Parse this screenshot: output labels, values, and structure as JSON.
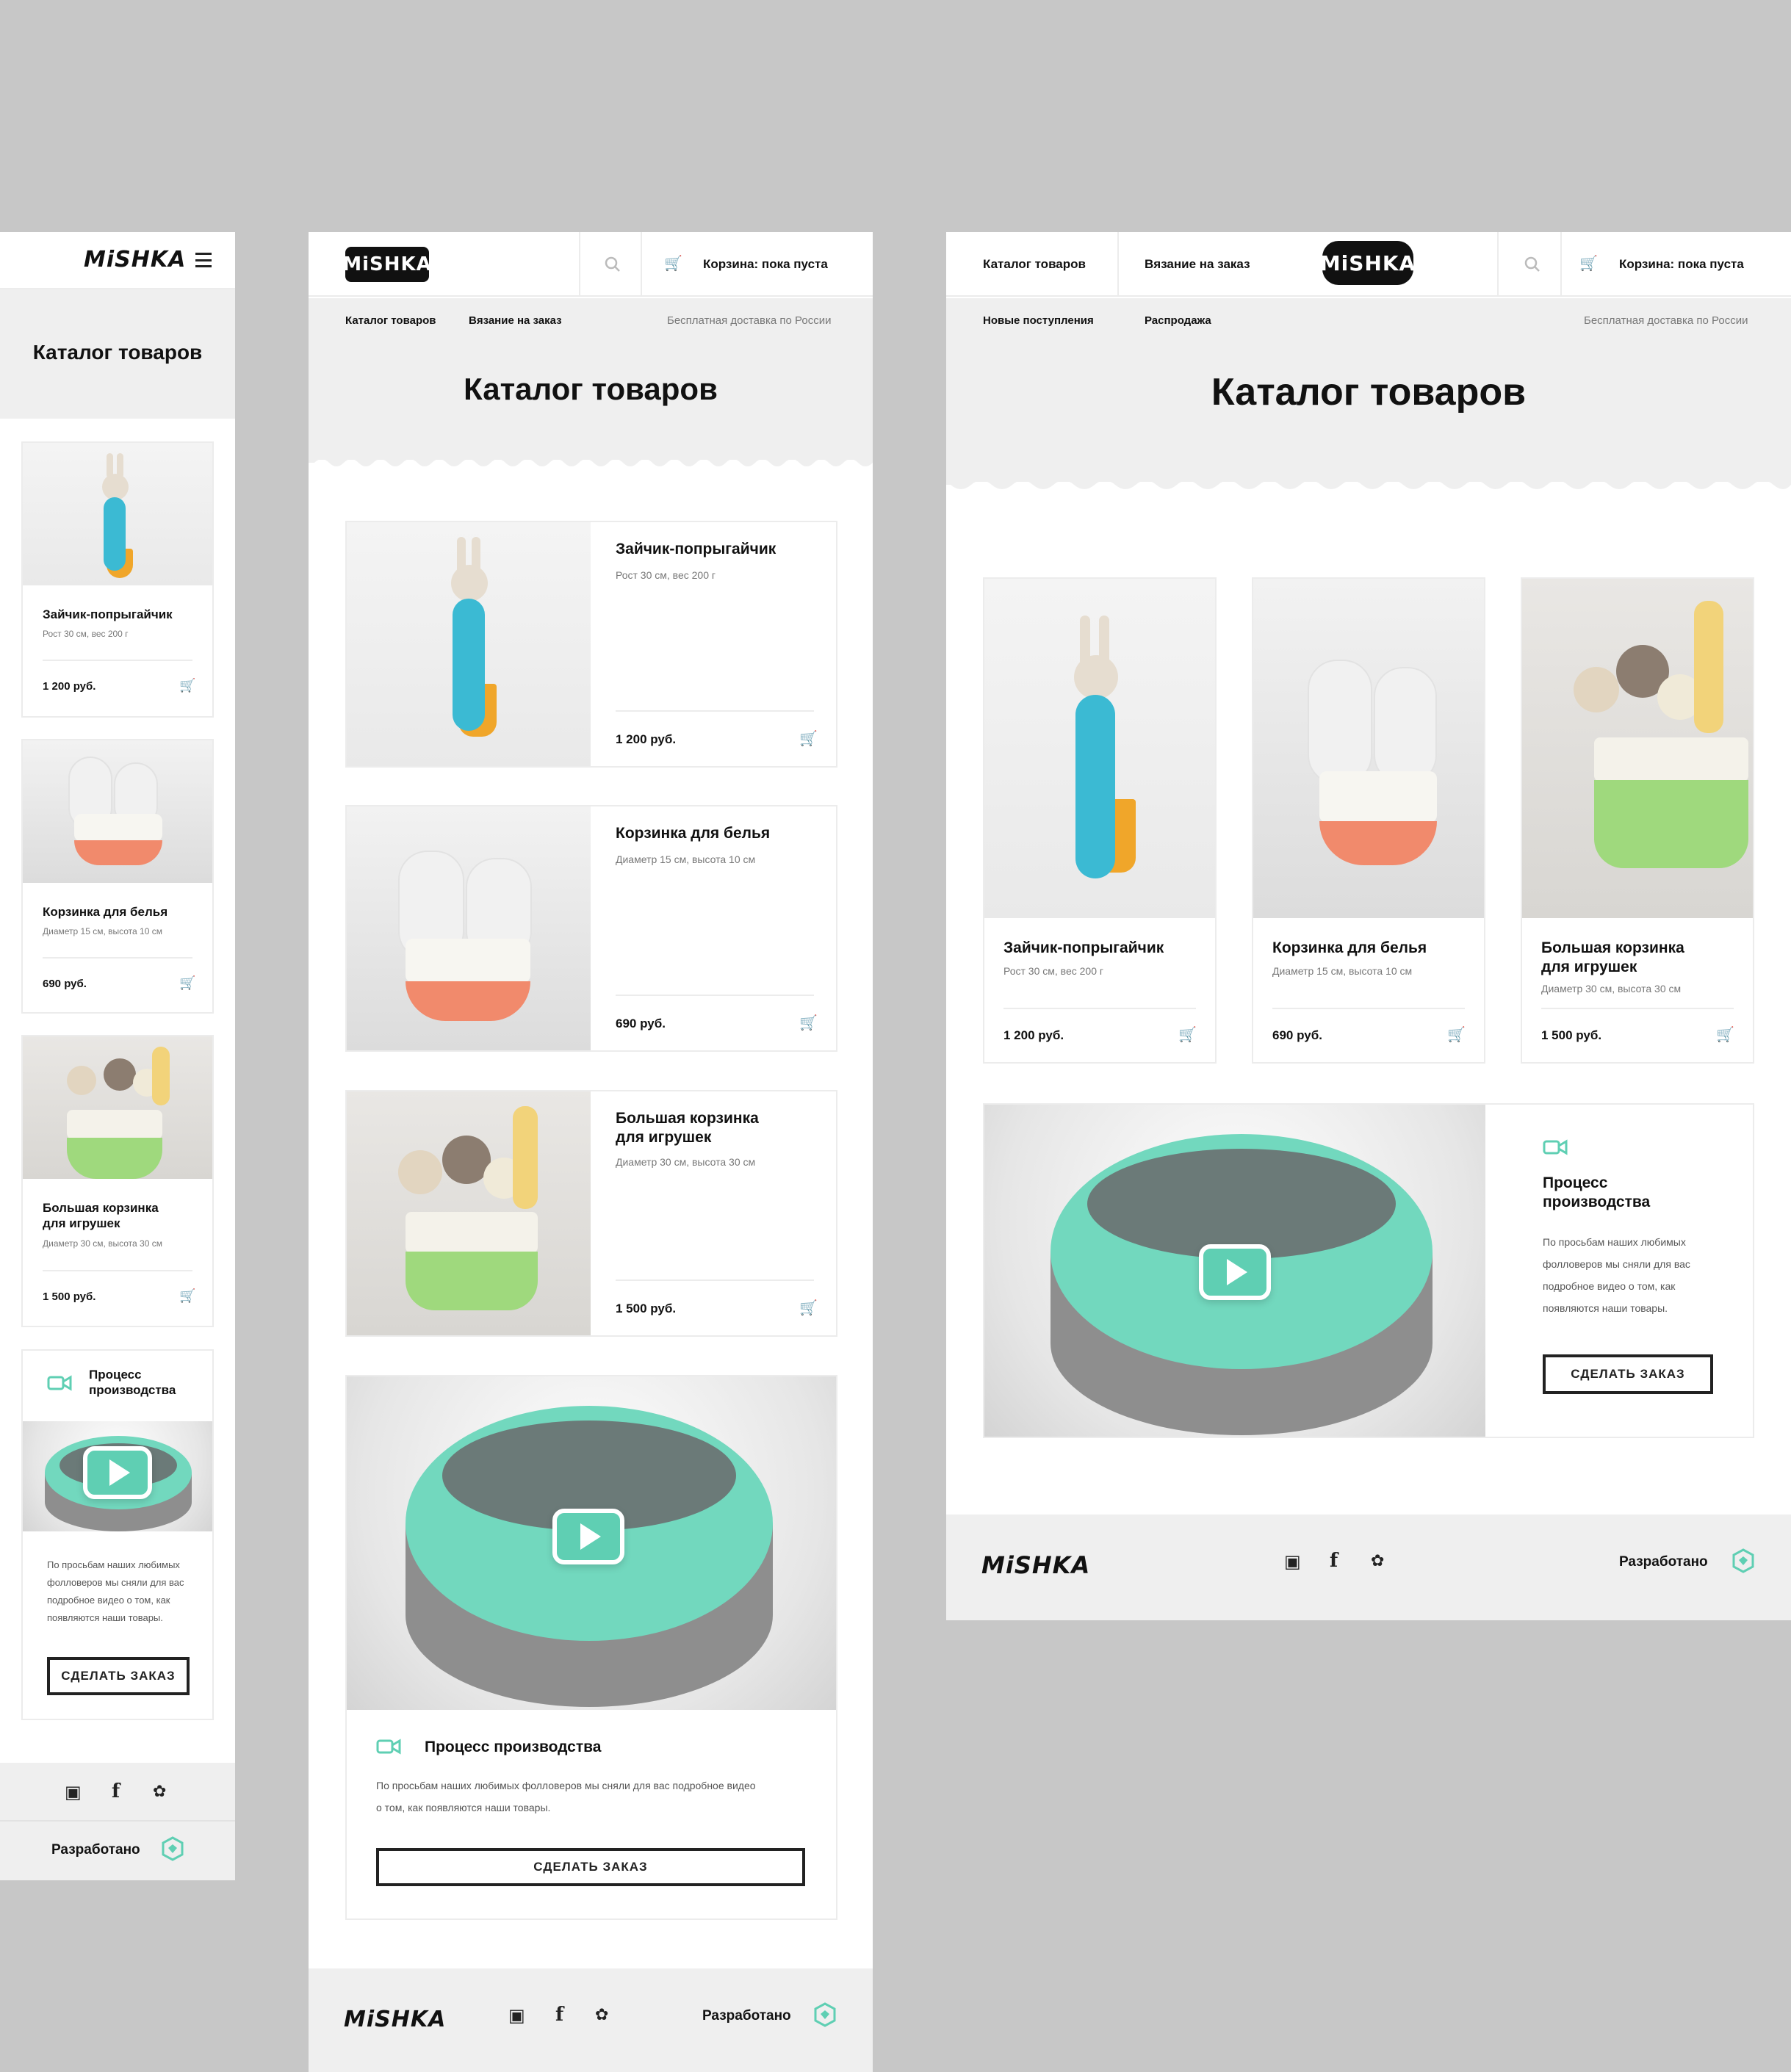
{
  "brand": {
    "logo": "MiSHKA"
  },
  "colors": {
    "accent": "#5fcfb3",
    "background": "#c7c7c7",
    "panel": "#efefef",
    "text": "#111111"
  },
  "nav": {
    "catalog": "Каталог товаров",
    "knitting": "Вязание на заказ",
    "new": "Новые поступления",
    "sale": "Распродажа",
    "delivery": "Бесплатная доставка по России",
    "cart": "Корзина: пока пуста",
    "search_icon": "search-icon",
    "cart_icon": "basket-icon",
    "menu_icon": "hamburger-icon"
  },
  "page": {
    "title": "Каталог товаров"
  },
  "products": [
    {
      "name": "Зайчик-попрыгайчик",
      "name_l1": "Зайчик-попрыгайчик",
      "name_l2": "",
      "desc": "Рост 30 см, вес 200 г",
      "price": "1 200 руб."
    },
    {
      "name": "Корзинка для белья",
      "name_l1": "Корзинка для белья",
      "name_l2": "",
      "desc": "Диаметр 15 см, высота 10 см",
      "price": "690 руб."
    },
    {
      "name": "Большая корзинка для игрушек",
      "name_l1": "Большая корзинка",
      "name_l2": "для игрушек",
      "desc": "Диаметр 30 см, высота 30 см",
      "price": "1 500 руб."
    }
  ],
  "video": {
    "title": "Процесс производства",
    "title_l1": "Процесс",
    "title_l2": "производства",
    "text": "По просьбам наших любимых фолловеров мы сняли для вас подробное видео о том, как появляются наши товары.",
    "tablet_l1": "По просьбам наших любимых фолловеров мы сняли для вас подробное видео",
    "tablet_l2": "о том, как появляются наши товары.",
    "desk_l1": "По просьбам наших любимых",
    "desk_l2": "фолловеров мы сняли для вас",
    "desk_l3": "подробное видео о том, как",
    "desk_l4": "появляются наши товары.",
    "mob_l1": "По просьбам наших любимых",
    "mob_l2": "фолловеров мы сняли для вас",
    "mob_l3": "подробное видео о том, как",
    "mob_l4": "появляются наши товары.",
    "button": "СДЕЛАТЬ ЗАКАЗ",
    "icon": "video-camera-icon"
  },
  "footer": {
    "developed": "Разработано",
    "socials": [
      "instagram-icon",
      "facebook-icon",
      "twitter-icon"
    ],
    "dev_icon": "htmlacademy-shield-icon"
  }
}
